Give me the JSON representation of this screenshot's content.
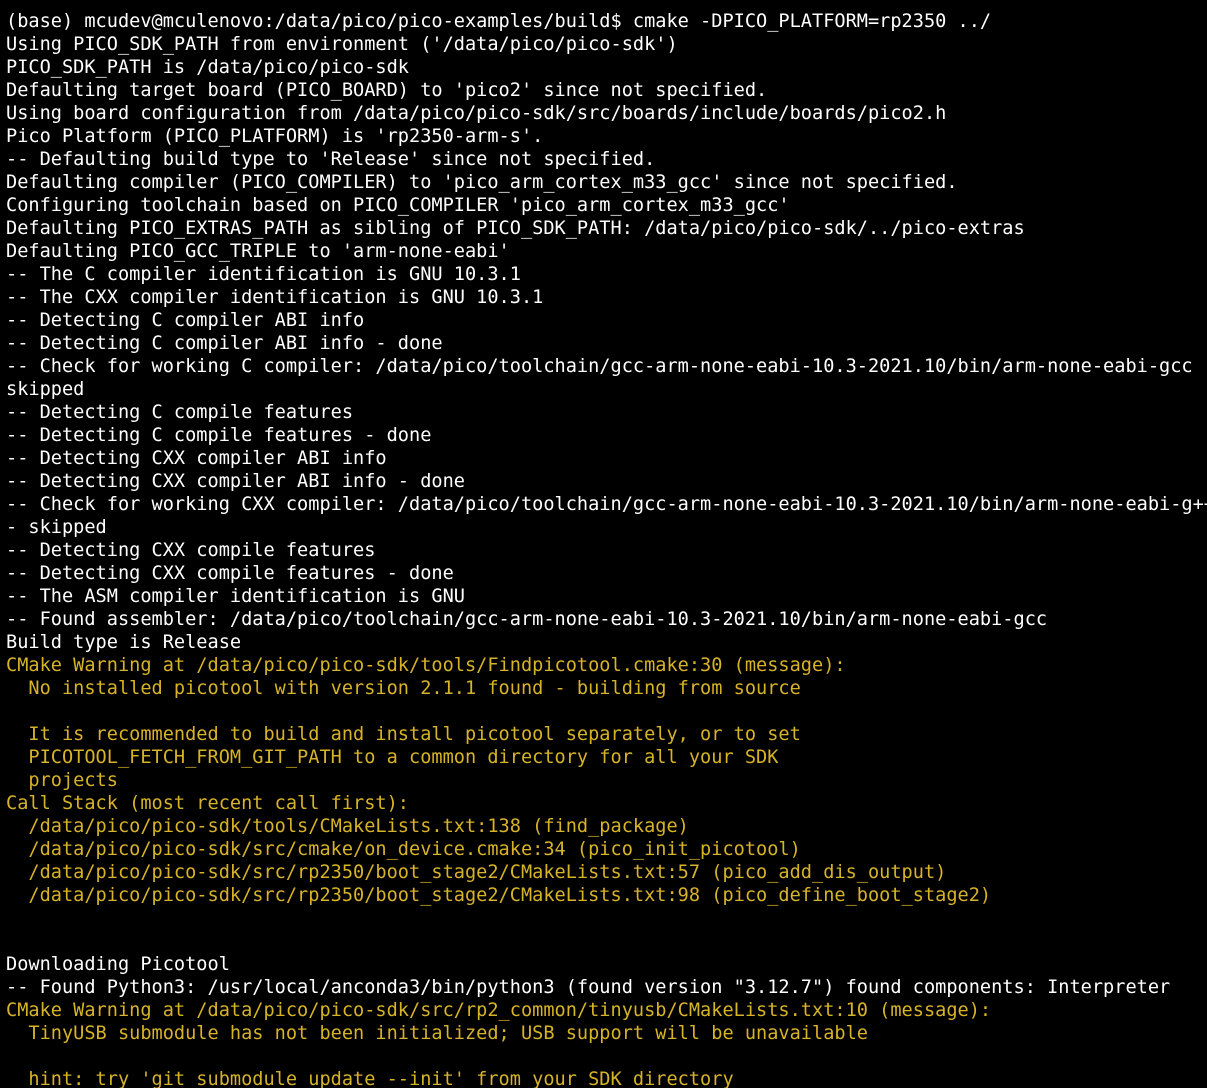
{
  "terminal": {
    "colors": {
      "background": "#000000",
      "text": "#ffffff",
      "warning": "#d7b327"
    },
    "lines": [
      {
        "text": "(base) mcudev@mculenovo:/data/pico/pico-examples/build$ cmake -DPICO_PLATFORM=rp2350 ../",
        "style": "normal"
      },
      {
        "text": "Using PICO_SDK_PATH from environment ('/data/pico/pico-sdk')",
        "style": "normal"
      },
      {
        "text": "PICO_SDK_PATH is /data/pico/pico-sdk",
        "style": "normal"
      },
      {
        "text": "Defaulting target board (PICO_BOARD) to 'pico2' since not specified.",
        "style": "normal"
      },
      {
        "text": "Using board configuration from /data/pico/pico-sdk/src/boards/include/boards/pico2.h",
        "style": "normal"
      },
      {
        "text": "Pico Platform (PICO_PLATFORM) is 'rp2350-arm-s'.",
        "style": "normal"
      },
      {
        "text": "-- Defaulting build type to 'Release' since not specified.",
        "style": "normal"
      },
      {
        "text": "Defaulting compiler (PICO_COMPILER) to 'pico_arm_cortex_m33_gcc' since not specified.",
        "style": "normal"
      },
      {
        "text": "Configuring toolchain based on PICO_COMPILER 'pico_arm_cortex_m33_gcc'",
        "style": "normal"
      },
      {
        "text": "Defaulting PICO_EXTRAS_PATH as sibling of PICO_SDK_PATH: /data/pico/pico-sdk/../pico-extras",
        "style": "normal"
      },
      {
        "text": "Defaulting PICO_GCC_TRIPLE to 'arm-none-eabi'",
        "style": "normal"
      },
      {
        "text": "-- The C compiler identification is GNU 10.3.1",
        "style": "normal"
      },
      {
        "text": "-- The CXX compiler identification is GNU 10.3.1",
        "style": "normal"
      },
      {
        "text": "-- Detecting C compiler ABI info",
        "style": "normal"
      },
      {
        "text": "-- Detecting C compiler ABI info - done",
        "style": "normal"
      },
      {
        "text": "-- Check for working C compiler: /data/pico/toolchain/gcc-arm-none-eabi-10.3-2021.10/bin/arm-none-eabi-gcc -",
        "style": "normal"
      },
      {
        "text": "skipped",
        "style": "normal"
      },
      {
        "text": "-- Detecting C compile features",
        "style": "normal"
      },
      {
        "text": "-- Detecting C compile features - done",
        "style": "normal"
      },
      {
        "text": "-- Detecting CXX compiler ABI info",
        "style": "normal"
      },
      {
        "text": "-- Detecting CXX compiler ABI info - done",
        "style": "normal"
      },
      {
        "text": "-- Check for working CXX compiler: /data/pico/toolchain/gcc-arm-none-eabi-10.3-2021.10/bin/arm-none-eabi-g++",
        "style": "normal"
      },
      {
        "text": "- skipped",
        "style": "normal"
      },
      {
        "text": "-- Detecting CXX compile features",
        "style": "normal"
      },
      {
        "text": "-- Detecting CXX compile features - done",
        "style": "normal"
      },
      {
        "text": "-- The ASM compiler identification is GNU",
        "style": "normal"
      },
      {
        "text": "-- Found assembler: /data/pico/toolchain/gcc-arm-none-eabi-10.3-2021.10/bin/arm-none-eabi-gcc",
        "style": "normal"
      },
      {
        "text": "Build type is Release",
        "style": "normal"
      },
      {
        "text": "CMake Warning at /data/pico/pico-sdk/tools/Findpicotool.cmake:30 (message):",
        "style": "warn"
      },
      {
        "text": "  No installed picotool with version 2.1.1 found - building from source",
        "style": "warn"
      },
      {
        "text": "",
        "style": "warn"
      },
      {
        "text": "  It is recommended to build and install picotool separately, or to set",
        "style": "warn"
      },
      {
        "text": "  PICOTOOL_FETCH_FROM_GIT_PATH to a common directory for all your SDK",
        "style": "warn"
      },
      {
        "text": "  projects",
        "style": "warn"
      },
      {
        "text": "Call Stack (most recent call first):",
        "style": "warn"
      },
      {
        "text": "  /data/pico/pico-sdk/tools/CMakeLists.txt:138 (find_package)",
        "style": "warn"
      },
      {
        "text": "  /data/pico/pico-sdk/src/cmake/on_device.cmake:34 (pico_init_picotool)",
        "style": "warn"
      },
      {
        "text": "  /data/pico/pico-sdk/src/rp2350/boot_stage2/CMakeLists.txt:57 (pico_add_dis_output)",
        "style": "warn"
      },
      {
        "text": "  /data/pico/pico-sdk/src/rp2350/boot_stage2/CMakeLists.txt:98 (pico_define_boot_stage2)",
        "style": "warn"
      },
      {
        "text": "",
        "style": "warn"
      },
      {
        "text": "",
        "style": "normal"
      },
      {
        "text": "Downloading Picotool",
        "style": "normal"
      },
      {
        "text": "-- Found Python3: /usr/local/anconda3/bin/python3 (found version \"3.12.7\") found components: Interpreter",
        "style": "normal"
      },
      {
        "text": "CMake Warning at /data/pico/pico-sdk/src/rp2_common/tinyusb/CMakeLists.txt:10 (message):",
        "style": "warn"
      },
      {
        "text": "  TinyUSB submodule has not been initialized; USB support will be unavailable",
        "style": "warn"
      },
      {
        "text": "",
        "style": "warn"
      },
      {
        "text": "  hint: try 'git submodule update --init' from your SDK directory",
        "style": "warn"
      }
    ]
  }
}
